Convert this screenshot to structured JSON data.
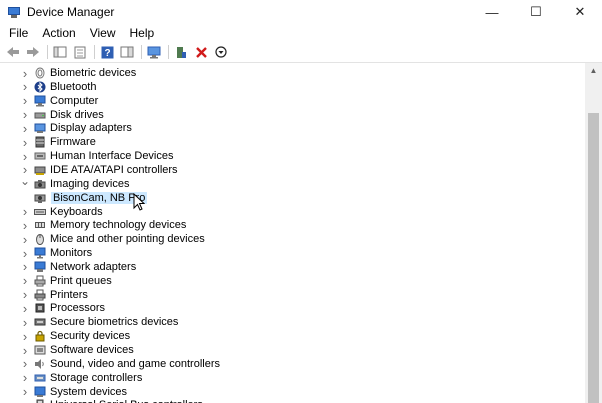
{
  "window": {
    "title": "Device Manager"
  },
  "window_controls": {
    "minimize": "—",
    "maximize": "☐",
    "close": "✕"
  },
  "menu": [
    "File",
    "Action",
    "View",
    "Help"
  ],
  "tree": [
    {
      "label": "Biometric devices",
      "icon": "fingerprint-icon",
      "expanded": false
    },
    {
      "label": "Bluetooth",
      "icon": "bluetooth-icon",
      "expanded": false
    },
    {
      "label": "Computer",
      "icon": "computer-icon",
      "expanded": false
    },
    {
      "label": "Disk drives",
      "icon": "disk-drive-icon",
      "expanded": false
    },
    {
      "label": "Display adapters",
      "icon": "display-adapter-icon",
      "expanded": false
    },
    {
      "label": "Firmware",
      "icon": "firmware-icon",
      "expanded": false
    },
    {
      "label": "Human Interface Devices",
      "icon": "hid-icon",
      "expanded": false
    },
    {
      "label": "IDE ATA/ATAPI controllers",
      "icon": "ide-controller-icon",
      "expanded": false
    },
    {
      "label": "Imaging devices",
      "icon": "camera-icon",
      "expanded": true
    },
    {
      "label": "BisonCam, NB Pro",
      "icon": "webcam-icon",
      "child": true,
      "selected": true
    },
    {
      "label": "Keyboards",
      "icon": "keyboard-icon",
      "expanded": false
    },
    {
      "label": "Memory technology devices",
      "icon": "memory-icon",
      "expanded": false
    },
    {
      "label": "Mice and other pointing devices",
      "icon": "mouse-icon",
      "expanded": false
    },
    {
      "label": "Monitors",
      "icon": "monitor-icon",
      "expanded": false
    },
    {
      "label": "Network adapters",
      "icon": "network-adapter-icon",
      "expanded": false
    },
    {
      "label": "Print queues",
      "icon": "print-queue-icon",
      "expanded": false
    },
    {
      "label": "Printers",
      "icon": "printer-icon",
      "expanded": false
    },
    {
      "label": "Processors",
      "icon": "processor-icon",
      "expanded": false
    },
    {
      "label": "Secure biometrics devices",
      "icon": "secure-biometric-icon",
      "expanded": false
    },
    {
      "label": "Security devices",
      "icon": "security-device-icon",
      "expanded": false
    },
    {
      "label": "Software devices",
      "icon": "software-device-icon",
      "expanded": false
    },
    {
      "label": "Sound, video and game controllers",
      "icon": "sound-icon",
      "expanded": false
    },
    {
      "label": "Storage controllers",
      "icon": "storage-controller-icon",
      "expanded": false
    },
    {
      "label": "System devices",
      "icon": "system-device-icon",
      "expanded": false
    },
    {
      "label": "Universal Serial Bus controllers",
      "icon": "usb-icon",
      "expanded": false
    }
  ],
  "colors": {
    "selection": "#cce8ff",
    "accent": "#3a7bd5"
  }
}
